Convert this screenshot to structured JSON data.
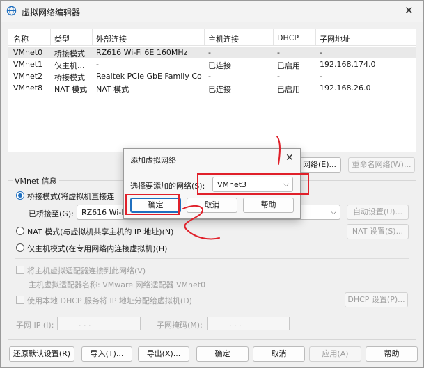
{
  "window": {
    "title": "虚拟网络编辑器",
    "icons": {
      "app": "globe-icon",
      "close": "close-icon"
    }
  },
  "network_list": {
    "columns": [
      "名称",
      "类型",
      "外部连接",
      "主机连接",
      "DHCP",
      "子网地址"
    ],
    "rows": [
      {
        "name": "VMnet0",
        "type": "桥接模式",
        "external": "RZ616 Wi-Fi 6E 160MHz",
        "host": "-",
        "dhcp": "-",
        "subnet": "-"
      },
      {
        "name": "VMnet1",
        "type": "仅主机...",
        "external": "-",
        "host": "已连接",
        "dhcp": "已启用",
        "subnet": "192.168.174.0"
      },
      {
        "name": "VMnet2",
        "type": "桥接模式",
        "external": "Realtek PCIe GbE Family Co...",
        "host": "-",
        "dhcp": "-",
        "subnet": "-"
      },
      {
        "name": "VMnet8",
        "type": "NAT 模式",
        "external": "NAT 模式",
        "host": "已连接",
        "dhcp": "已启用",
        "subnet": "192.168.26.0"
      }
    ]
  },
  "list_actions": {
    "add_network_tail": "网络(E)...",
    "rename_network": "重命名网络(W)..."
  },
  "vmnet_info": {
    "title": "VMnet 信息",
    "bridged_mode": "桥接模式(将虚拟机直接连",
    "bridged_to_label": "已桥接至(G):",
    "bridged_to_value": "RZ616 Wi-Fi",
    "auto_settings": "自动设置(U)...",
    "nat_mode": "NAT 模式(与虚拟机共享主机的 IP 地址)(N)",
    "nat_settings": "NAT 设置(S)...",
    "host_only": "仅主机模式(在专用网络内连接虚拟机)(H)",
    "connect_adapter": "将主机虚拟适配器连接到此网络(V)",
    "adapter_name": "主机虚拟适配器名称: VMware 网络适配器 VMnet0",
    "use_dhcp": "使用本地 DHCP 服务将 IP 地址分配给虚拟机(D)",
    "dhcp_settings": "DHCP 设置(P)...",
    "subnet_ip_label": "子网 IP (I):",
    "subnet_mask_label": "子网掩码(M):",
    "ip_placeholder": ".   .   ."
  },
  "footer": {
    "restore_defaults": "还原默认设置(R)",
    "import": "导入(T)...",
    "export": "导出(X)...",
    "ok": "确定",
    "cancel": "取消",
    "apply": "应用(A)",
    "help": "帮助"
  },
  "add_dialog": {
    "title": "添加虚拟网络",
    "select_label": "选择要添加的网络(S):",
    "selected_network": "VMnet3",
    "ok": "确定",
    "cancel": "取消",
    "help": "帮助"
  },
  "colors": {
    "annotation": "#e0202a",
    "accent": "#1f6fbf"
  }
}
